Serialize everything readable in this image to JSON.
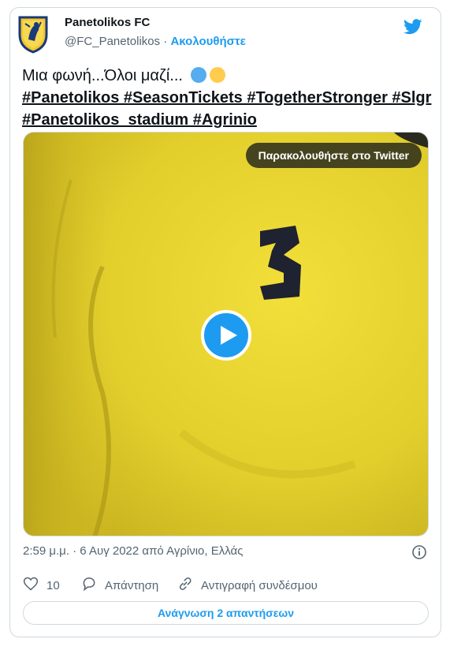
{
  "tweet": {
    "author_name": "Panetolikos FC",
    "handle": "@FC_Panetolikos",
    "separator": " · ",
    "follow_label": "Ακολουθήστε",
    "text": "Μια φωνή...Όλοι μαζί...",
    "hashtags_line1": "#Panetolikos #SeasonTickets #TogetherStronger #Slgr",
    "hashtags_line2": "#Panetolikos_stadium #Agrinio",
    "emoji_colors": [
      "#55acee",
      "#ffcc4d"
    ],
    "media_overlay_label": "Παρακολουθήστε στο Twitter",
    "timestamp": "2:59 μ.μ. · 6 Αυγ 2022 από Αγρίνιο, Ελλάς",
    "like_count": "10",
    "reply_label": "Απάντηση",
    "copy_link_label": "Αντιγραφή συνδέσμου",
    "read_replies_label": "Ανάγνωση 2 απαντήσεων"
  },
  "colors": {
    "accent": "#1d9bf0",
    "shirt": "#e8d530",
    "badge_gold": "#f2c530"
  },
  "icons": [
    "club-crest-icon",
    "twitter-bird-icon",
    "play-icon",
    "info-icon",
    "heart-icon",
    "reply-icon",
    "link-icon"
  ]
}
